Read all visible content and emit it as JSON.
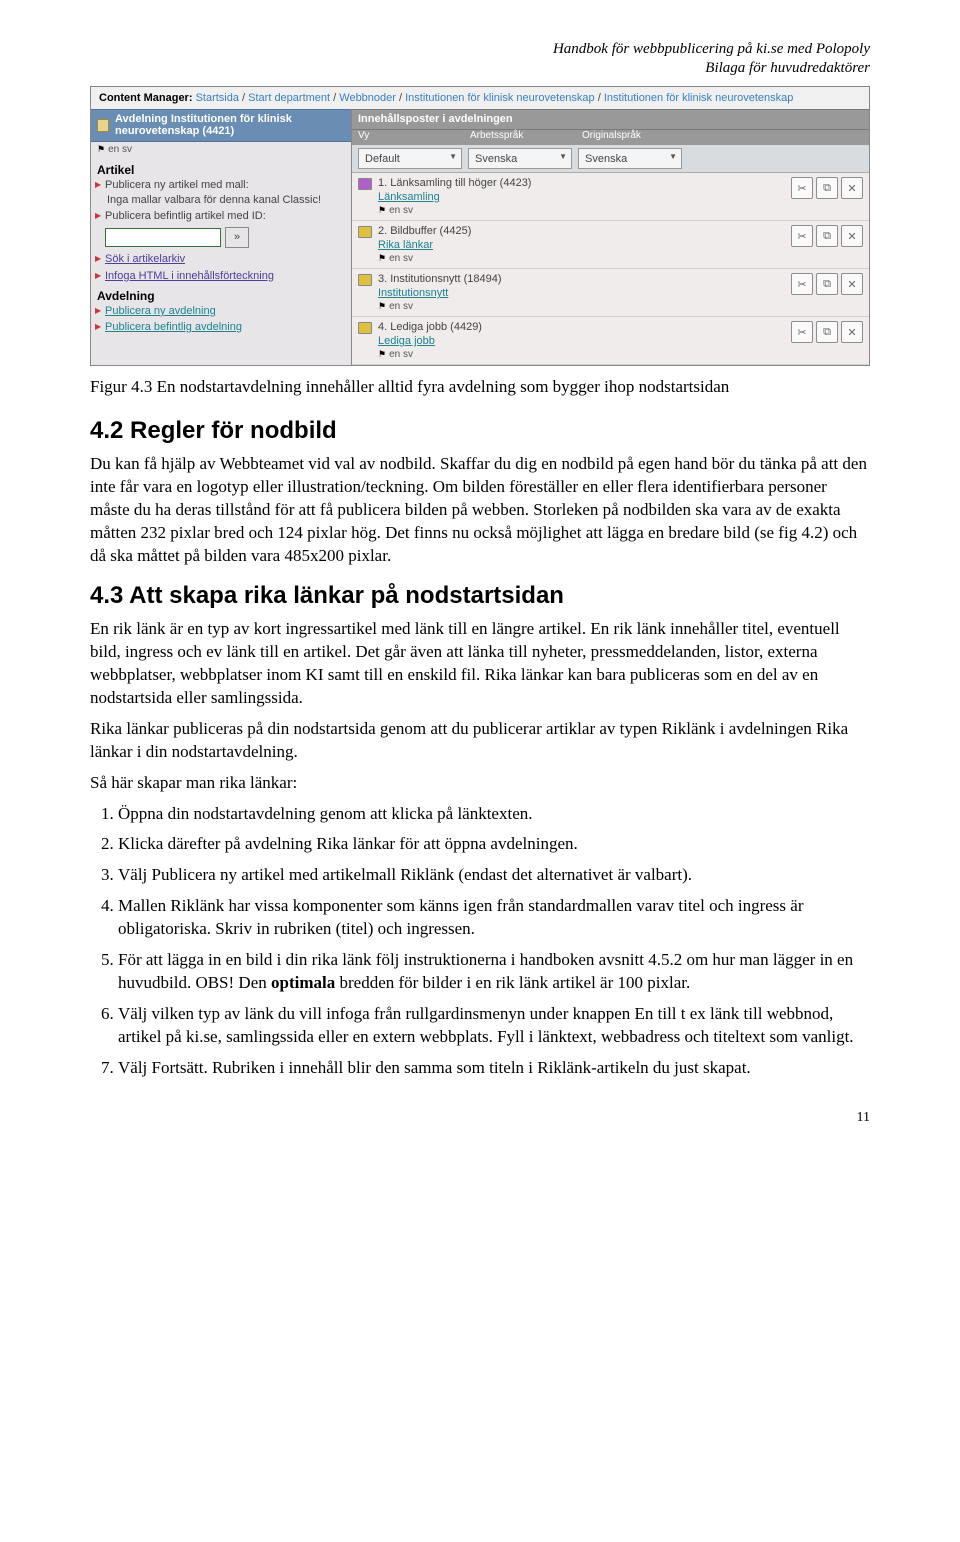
{
  "meta": {
    "line1": "Handbok för webbpublicering på ki.se med Polopoly",
    "line2": "Bilaga för huvudredaktörer"
  },
  "cm": {
    "label": "Content Manager:",
    "crumbs": [
      "Startsida",
      "Start department",
      "Webbnoder",
      "Institutionen för klinisk neurovetenskap",
      "Institutionen för klinisk neurovetenskap"
    ],
    "left": {
      "avd_title": "Avdelning Institutionen för klinisk neurovetenskap (4421)",
      "flags": "en sv",
      "artikel_head": "Artikel",
      "pub_new": "Publicera ny artikel med mall:",
      "no_template": "Inga mallar valbara för denna kanal Classic!",
      "pub_existing": "Publicera befintlig artikel med ID:",
      "go": "»",
      "search_archive": "Sök i artikelarkiv",
      "infoga_html": "Infoga HTML i innehållsförteckning",
      "avdelning_head": "Avdelning",
      "pub_new_avd": "Publicera ny avdelning",
      "pub_existing_avd": "Publicera befintlig avdelning"
    },
    "right": {
      "header": "Innehållsposter i avdelningen",
      "col_vy": "Vy",
      "col_arb": "Arbetsspråk",
      "col_orig": "Originalspråk",
      "sel_vy": "Default",
      "sel_arb": "Svenska",
      "sel_orig": "Svenska",
      "items": [
        {
          "num": "1.",
          "title": "Länksamling till höger (4423)",
          "link": "Länksamling",
          "flags": "en sv",
          "iconColor": "#b060c8"
        },
        {
          "num": "2.",
          "title": "Bildbuffer (4425)",
          "link": "Rika länkar",
          "flags": "en sv",
          "iconColor": "#e0c040"
        },
        {
          "num": "3.",
          "title": "Institutionsnytt (18494)",
          "link": "Institutionsnytt",
          "flags": "en sv",
          "iconColor": "#e0c040"
        },
        {
          "num": "4.",
          "title": "Lediga jobb (4429)",
          "link": "Lediga jobb",
          "flags": "en sv",
          "iconColor": "#e0c040"
        }
      ]
    }
  },
  "fig_caption": "Figur 4.3 En nodstartavdelning innehåller alltid fyra avdelning som bygger ihop nodstartsidan",
  "s42": {
    "title": "4.2 Regler för nodbild",
    "p1": "Du kan få hjälp av Webbteamet vid val av nodbild. Skaffar du dig en nodbild på egen hand bör du tänka på att den inte får vara en logotyp eller illustration/teckning. Om bilden föreställer en eller flera identifierbara personer måste du ha deras tillstånd för att få publicera bilden på webben. Storleken på nodbilden ska vara av de exakta måtten 232 pixlar bred och 124 pixlar hög. Det finns nu också möjlighet att lägga en bredare bild (se fig 4.2) och då ska måttet på bilden vara 485x200 pixlar."
  },
  "s43": {
    "title": "4.3 Att skapa rika länkar på nodstartsidan",
    "p1": "En rik länk är en typ av kort ingressartikel med länk till en längre artikel. En rik länk innehåller titel, eventuell bild, ingress och ev länk till en artikel. Det går även att länka till nyheter, pressmeddelanden, listor, externa webbplatser, webbplatser inom KI samt till en enskild fil. Rika länkar kan bara publiceras som en del av en nodstartsida eller samlingssida.",
    "p2": "Rika länkar publiceras på din nodstartsida genom att du publicerar artiklar av typen Riklänk i avdelningen Rika länkar i din nodstartavdelning.",
    "p3": "Så här skapar man rika länkar:",
    "steps": [
      "Öppna din nodstartavdelning genom att klicka på länktexten.",
      "Klicka därefter på avdelning Rika länkar för att öppna avdelningen.",
      "Välj Publicera ny artikel med artikelmall Riklänk (endast det alternativet är valbart).",
      "Mallen Riklänk har vissa komponenter som känns igen från standardmallen varav titel och ingress är obligatoriska. Skriv in rubriken (titel) och ingressen.",
      "För att lägga in en bild i din rika länk följ instruktionerna i handboken avsnitt 4.5.2 om hur man lägger in en huvudbild. OBS! Den <b>optimala</b> bredden för bilder i en rik länk artikel är 100 pixlar.",
      "Välj vilken typ av länk du vill infoga från rullgardinsmenyn under knappen En till t ex länk till webbnod, artikel på ki.se, samlingssida eller en extern webbplats. Fyll i länktext, webbadress och titeltext som vanligt.",
      "Välj Fortsätt. Rubriken i innehåll blir den samma som titeln i Riklänk-artikeln du just skapat."
    ]
  },
  "pagenum": "11"
}
